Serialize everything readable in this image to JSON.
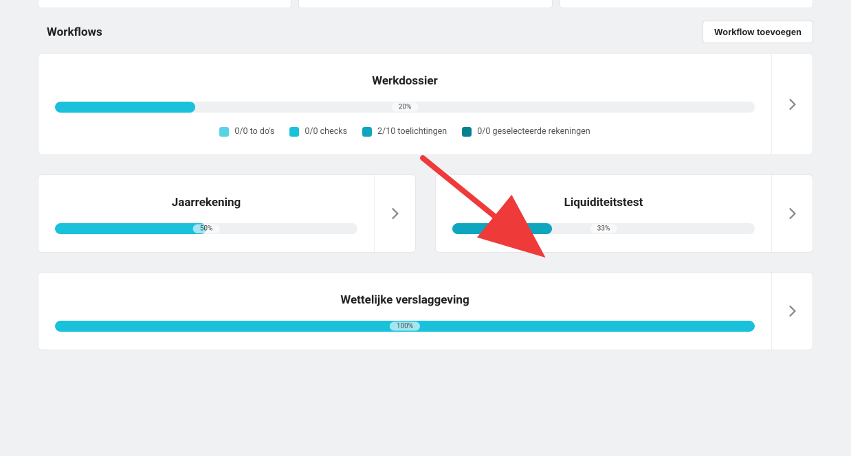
{
  "section": {
    "title": "Workflows",
    "add_button": "Workflow toevoegen"
  },
  "workflows": {
    "werkdossier": {
      "title": "Werkdossier",
      "percent_label": "20%",
      "percent": 20,
      "legend": [
        {
          "color": "#57d3e6",
          "label": "0/0 to do's"
        },
        {
          "color": "#1ac1db",
          "label": "0/0 checks"
        },
        {
          "color": "#0ea6bf",
          "label": "2/10 toelichtingen"
        },
        {
          "color": "#07808f",
          "label": "0/0 geselecteerde rekeningen"
        }
      ]
    },
    "jaarrekening": {
      "title": "Jaarrekening",
      "percent_label": "50%",
      "percent": 50
    },
    "liquiditeitstest": {
      "title": "Liquiditeitstest",
      "percent_label": "33%",
      "percent": 33
    },
    "wettelijke": {
      "title": "Wettelijke verslaggeving",
      "percent_label": "100%",
      "percent": 100
    }
  }
}
